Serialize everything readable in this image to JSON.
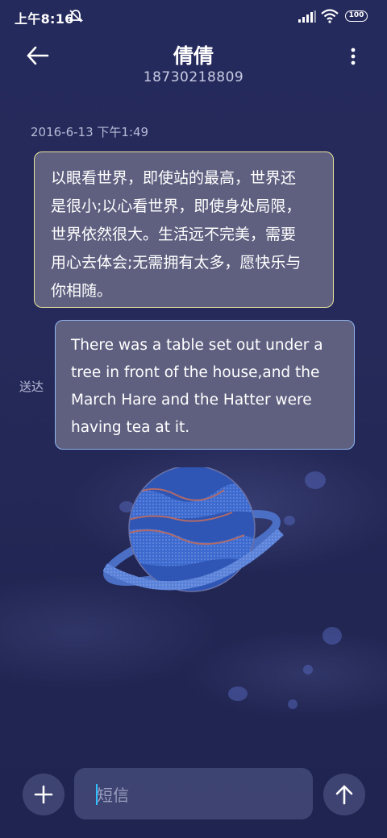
{
  "status_bar": {
    "time": "上午8:16",
    "battery": "100",
    "icons": [
      "mute-icon",
      "signal-icon",
      "wifi-icon",
      "battery-icon"
    ]
  },
  "header": {
    "title": "倩倩",
    "phone": "18730218809",
    "back_icon": "back-arrow-icon",
    "more_icon": "more-vertical-icon"
  },
  "conversation": {
    "timestamp": "2016-6-13 下午1:49",
    "messages": [
      {
        "direction": "incoming",
        "lines": [
          "以眼看世界，即使站的最高，世界还",
          "是很小;以心看世界，即使身处局限，",
          "世界依然很大。生活远不完美，需要",
          "用心去体会;无需拥有太多，愿快乐与",
          "你相随。"
        ]
      },
      {
        "direction": "outgoing",
        "status": "送达",
        "lines": [
          "There was a table set out under a",
          "tree in front of the house,and the",
          "March Hare and the Hatter were",
          "having tea at it."
        ]
      }
    ]
  },
  "input_bar": {
    "placeholder": "短信",
    "add_icon": "plus-icon",
    "send_icon": "arrow-up-icon"
  },
  "colors": {
    "background": "#252a5c",
    "bubble": "#5f6080",
    "incoming_border": "#e7e49a",
    "outgoing_border": "#8fb4f0",
    "cursor": "#2ec0ff"
  }
}
